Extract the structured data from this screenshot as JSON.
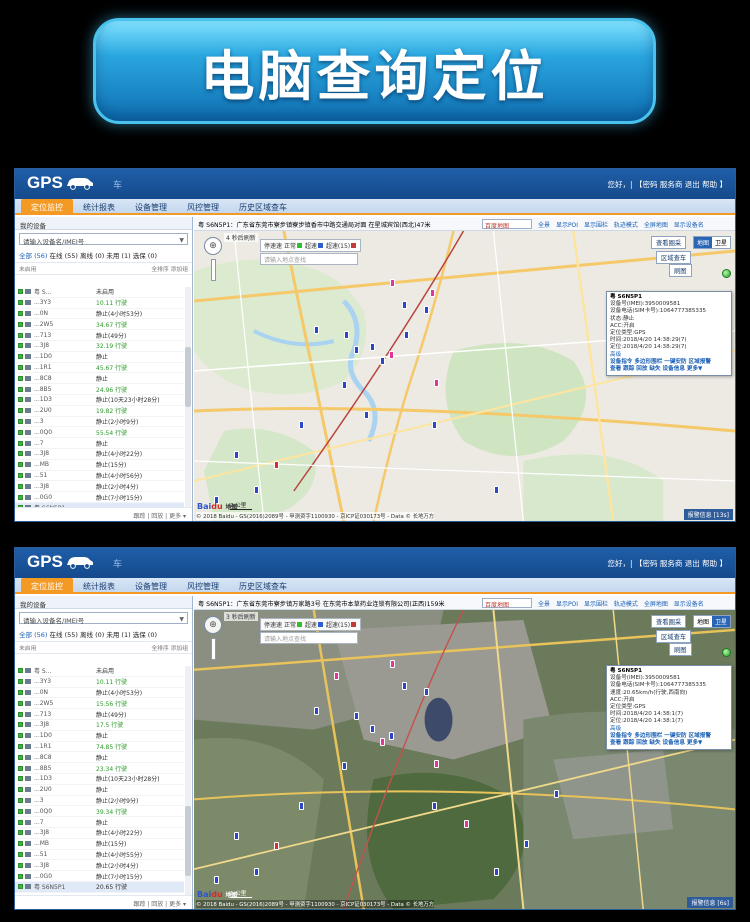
{
  "banner": {
    "title": "电脑查询定位"
  },
  "common": {
    "logo": "GPS",
    "brand": "车",
    "user": "您好，",
    "user_links": "| 【密码  服务商  退出  帮助 】",
    "tabs": [
      "定位监控",
      "统计报表",
      "设备管理",
      "风控管理",
      "历史区域查车"
    ],
    "panel_head": "我的设备",
    "search_placeholder": "请输入设备名/IMEI号",
    "filters": {
      "all": "全部 (56)",
      "online": "在线 (55)",
      "offline": "离线 (0)",
      "inactive": "未用 (1)",
      "chosen": "选保 (0)"
    },
    "list_sort": "全排序",
    "list_add": "添加组",
    "list_unnamed": "未启用",
    "footer": "跟踪 | 回放 | 更多 ▾",
    "zoom_label": "⊕",
    "refresh": "4 秒后刷新",
    "legend": {
      "label": "停速速",
      "normal": "正常",
      "slow": "超速",
      "over": "超速(15)"
    },
    "map_search_placeholder": "请输入地点查找",
    "map_select": "百度地图",
    "map_options": [
      "全景",
      "显示POI",
      "显示围栏",
      "轨迹模式",
      "全屏地图",
      "显示设备名"
    ],
    "map_buttons": {
      "view_zone": "查看圈采",
      "zone_search": "区域查车",
      "clear": "刷图"
    },
    "map_type": [
      "地图",
      "卫星"
    ],
    "baidu": "Bai",
    "baidu2": "du",
    "baidu_sub": "地图",
    "alarm": "报警信息"
  },
  "screen1": {
    "address": "粤 S6N5P1：广东省东莞市寮步镇寮步镇香市中路交通局对面 在星城宾馆(西北)47米",
    "refresh": "4 秒后刷新",
    "scale_text": "2 公里",
    "copyright": "© 2018 Baidu - GS(2016)2089号 - 甲测资字1100930 - 京ICP证030173号 - Data © 长地万方",
    "alarm_count": "报警信息 [13s]",
    "info": {
      "id": "粤 S6N5P1",
      "lines": [
        "设备号(IMEI):3950009581",
        "设备电话(SIM卡号):1064777385335",
        "状态:静止",
        "ACC:开启",
        "定位类型:GPS",
        "时间:2018/4/20 14:38:29(7)",
        "定位:2018/4/20 14:38:29(7)"
      ],
      "links1": "高级",
      "links2": "设备指令  多边形围栏  一键安防  区域报警",
      "links3": "查看  跟踪  回放  缺失  设备信息  更多▼"
    },
    "devices": [
      {
        "name": "粤 S...",
        "status": "未启用",
        "type": "stop"
      },
      {
        "name": "...3Y3",
        "status": "10.11 行驶",
        "type": "move"
      },
      {
        "name": "...0N",
        "status": "静止(4小时53分)",
        "type": "stop"
      },
      {
        "name": "...2W5",
        "status": "34.67 行驶",
        "type": "move"
      },
      {
        "name": "...713",
        "status": "静止(49分)",
        "type": "stop"
      },
      {
        "name": "...3J8",
        "status": "32.19 行驶",
        "type": "move"
      },
      {
        "name": "...1D0",
        "status": "静止",
        "type": "stop"
      },
      {
        "name": "...1R1",
        "status": "45.67 行驶",
        "type": "move"
      },
      {
        "name": "...8C8",
        "status": "静止",
        "type": "stop"
      },
      {
        "name": "...8B5",
        "status": "24.96 行驶",
        "type": "move"
      },
      {
        "name": "...1D3",
        "status": "静止(10天23小时28分)",
        "type": "stop"
      },
      {
        "name": "...2U0",
        "status": "19.82 行驶",
        "type": "move"
      },
      {
        "name": "...3",
        "status": "静止(2小时9分)",
        "type": "stop"
      },
      {
        "name": "...0Q0",
        "status": "55.54 行驶",
        "type": "move"
      },
      {
        "name": "...7",
        "status": "静止",
        "type": "stop"
      },
      {
        "name": "...3J8",
        "status": "静止(4小时22分)",
        "type": "stop"
      },
      {
        "name": "...MB",
        "status": "静止(15分)",
        "type": "stop"
      },
      {
        "name": "...51",
        "status": "静止(4小时56分)",
        "type": "stop"
      },
      {
        "name": "...3J8",
        "status": "静止(2小时4分)",
        "type": "stop"
      },
      {
        "name": "...0G0",
        "status": "静止(7小时15分)",
        "type": "stop"
      },
      {
        "name": "粤 S6N5P1",
        "status": "",
        "type": "sel"
      }
    ]
  },
  "screen2": {
    "address": "粤 S6N5P1：广东省东莞市寮步镇万家路3号 在东莞市本草药业连锁有限公司(正西)159米",
    "refresh": "3 秒后刷新",
    "scale_text": "1 公里",
    "copyright": "© 2018 Baidu - GS(2016)2089号 - 甲测资字1100930 - 京ICP证030173号 - Data © 长地万方",
    "alarm_count": "报警信息 [6s]",
    "info": {
      "id": "粤 S6N5P1",
      "lines": [
        "设备号(IMEI):3950009581",
        "设备电话(SIM卡号):1064777385335",
        "速度:20.65km/h(行驶,西南向)",
        "ACC:开启",
        "定位类型:GPS",
        "时间:2018/4/20 14:38:1(7)",
        "定位:2018/4/20 14:38:1(7)"
      ],
      "links1": "高级",
      "links2": "设备指令  多边形围栏  一键安防  区域报警",
      "links3": "查看  跟踪  回放  缺失  设备信息  更多▼"
    },
    "devices": [
      {
        "name": "粤 S...",
        "status": "未启用",
        "type": "stop"
      },
      {
        "name": "...3Y3",
        "status": "10.11 行驶",
        "type": "move"
      },
      {
        "name": "...0N",
        "status": "静止(4小时53分)",
        "type": "stop"
      },
      {
        "name": "...2W5",
        "status": "15.56 行驶",
        "type": "move"
      },
      {
        "name": "...713",
        "status": "静止(49分)",
        "type": "stop"
      },
      {
        "name": "...3J8",
        "status": "17.5 行驶",
        "type": "move"
      },
      {
        "name": "...1D0",
        "status": "静止",
        "type": "stop"
      },
      {
        "name": "...1R1",
        "status": "74.85 行驶",
        "type": "move"
      },
      {
        "name": "...8C8",
        "status": "静止",
        "type": "stop"
      },
      {
        "name": "...8B5",
        "status": "23.34 行驶",
        "type": "move"
      },
      {
        "name": "...1D3",
        "status": "静止(10天23小时28分)",
        "type": "stop"
      },
      {
        "name": "...2U0",
        "status": "静止",
        "type": "stop"
      },
      {
        "name": "...3",
        "status": "静止(2小时9分)",
        "type": "stop"
      },
      {
        "name": "...0Q0",
        "status": "39.34 行驶",
        "type": "move"
      },
      {
        "name": "...7",
        "status": "静止",
        "type": "stop"
      },
      {
        "name": "...3J8",
        "status": "静止(4小时22分)",
        "type": "stop"
      },
      {
        "name": "...MB",
        "status": "静止(15分)",
        "type": "stop"
      },
      {
        "name": "...51",
        "status": "静止(4小时55分)",
        "type": "stop"
      },
      {
        "name": "...3J8",
        "status": "静止(2小时4分)",
        "type": "stop"
      },
      {
        "name": "...0G0",
        "status": "静止(7小时15分)",
        "type": "stop"
      },
      {
        "name": "粤 S6N5P1",
        "status": "20.65 行驶",
        "type": "sel"
      }
    ]
  }
}
